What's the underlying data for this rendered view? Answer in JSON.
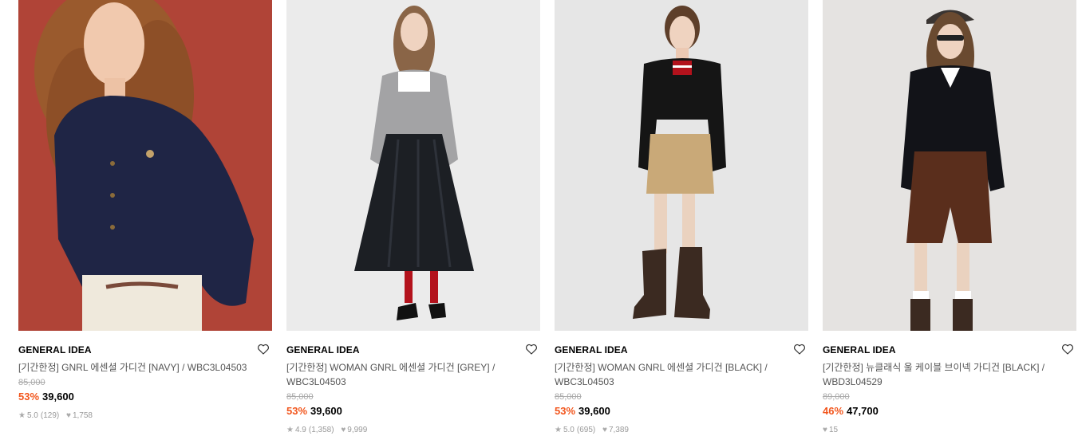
{
  "products": [
    {
      "brand": "GENERAL IDEA",
      "title": "[기간한정] GNRL 에센셜 가디건 [NAVY] / WBC3L04503",
      "original_price": "85,000",
      "discount": "53%",
      "price": "39,600",
      "rating": "5.0",
      "reviews": "(129)",
      "likes": "1,758",
      "photo": {
        "bg": "#b5473a",
        "top": "#1f2545",
        "bottom": "#efe9dc",
        "hair": "#9a5a2d"
      }
    },
    {
      "brand": "GENERAL IDEA",
      "title": "[기간한정] WOMAN GNRL 에센셜 가디건 [GREY] / WBC3L04503",
      "original_price": "85,000",
      "discount": "53%",
      "price": "39,600",
      "rating": "4.9",
      "reviews": "(1,358)",
      "likes": "9,999",
      "photo": {
        "bg": "#ebebeb",
        "top": "#a3a3a5",
        "bottom": "#1c1f24",
        "hair": "#8a6547"
      }
    },
    {
      "brand": "GENERAL IDEA",
      "title": "[기간한정] WOMAN GNRL 에센셜 가디건 [BLACK] / WBC3L04503",
      "original_price": "85,000",
      "discount": "53%",
      "price": "39,600",
      "rating": "5.0",
      "reviews": "(695)",
      "likes": "7,389",
      "photo": {
        "bg": "#e6e6e6",
        "top": "#151515",
        "bottom": "#c9a978",
        "hair": "#5e3f2a"
      }
    },
    {
      "brand": "GENERAL IDEA",
      "title": "[기간한정] 뉴클래식 울 케이블 브이넥 가디건 [BLACK] / WBD3L04529",
      "original_price": "89,000",
      "discount": "46%",
      "price": "47,700",
      "rating": "",
      "reviews": "",
      "likes": "15",
      "photo": {
        "bg": "#e5e3e1",
        "top": "#121318",
        "bottom": "#5a2e1c",
        "hair": "#6a4a30"
      }
    }
  ]
}
